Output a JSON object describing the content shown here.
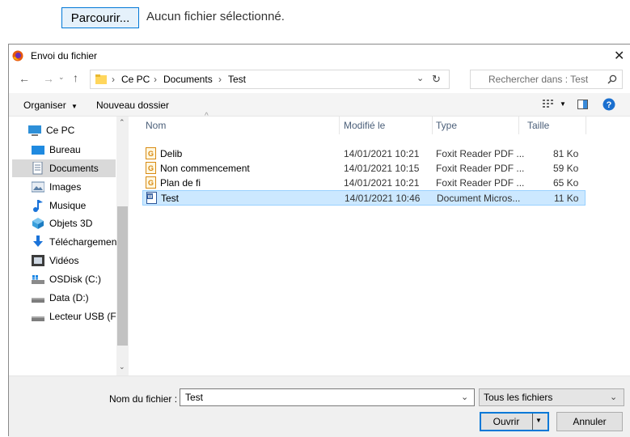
{
  "file_input": {
    "browse_label": "Parcourir...",
    "status": "Aucun fichier sélectionné."
  },
  "dialog": {
    "title": "Envoi du fichier",
    "breadcrumb": [
      "Ce PC",
      "Documents",
      "Test"
    ],
    "search_placeholder": "Rechercher dans : Test",
    "toolbar": {
      "organize_label": "Organiser",
      "new_folder_label": "Nouveau dossier"
    },
    "nav_items": [
      {
        "label": "Ce PC",
        "icon": "computer-icon"
      },
      {
        "label": "Bureau",
        "icon": "desktop-icon"
      },
      {
        "label": "Documents",
        "icon": "documents-icon",
        "selected": true
      },
      {
        "label": "Images",
        "icon": "images-icon"
      },
      {
        "label": "Musique",
        "icon": "music-icon"
      },
      {
        "label": "Objets 3D",
        "icon": "3d-objects-icon"
      },
      {
        "label": "Téléchargement",
        "icon": "download-icon"
      },
      {
        "label": "Vidéos",
        "icon": "videos-icon"
      },
      {
        "label": "OSDisk (C:)",
        "icon": "windows-drive-icon"
      },
      {
        "label": "Data (D:)",
        "icon": "drive-icon"
      },
      {
        "label": "Lecteur USB (F:)",
        "icon": "usb-drive-icon"
      }
    ],
    "columns": {
      "name": "Nom",
      "modified": "Modifié le",
      "type": "Type",
      "size": "Taille"
    },
    "files": [
      {
        "name": "Delib",
        "modified": "14/01/2021 10:21",
        "type": "Foxit Reader PDF ...",
        "size": "81 Ko",
        "icon": "pdf-file-icon",
        "selected": false
      },
      {
        "name": "Non commencement",
        "modified": "14/01/2021 10:15",
        "type": "Foxit Reader PDF ...",
        "size": "59 Ko",
        "icon": "pdf-file-icon",
        "selected": false
      },
      {
        "name": "Plan de fi",
        "modified": "14/01/2021 10:21",
        "type": "Foxit Reader PDF ...",
        "size": "65 Ko",
        "icon": "pdf-file-icon",
        "selected": false
      },
      {
        "name": "Test",
        "modified": "14/01/2021 10:46",
        "type": "Document Micros...",
        "size": "11 Ko",
        "icon": "word-file-icon",
        "selected": true
      }
    ],
    "filename_label": "Nom du fichier :",
    "filename_value": "Test",
    "filter_value": "Tous les fichiers",
    "open_label": "Ouvrir",
    "cancel_label": "Annuler"
  },
  "colors": {
    "selection_bg": "#cce8ff",
    "selection_border": "#99d1ff",
    "accent": "#0078d7",
    "header_text": "#4c607a"
  }
}
